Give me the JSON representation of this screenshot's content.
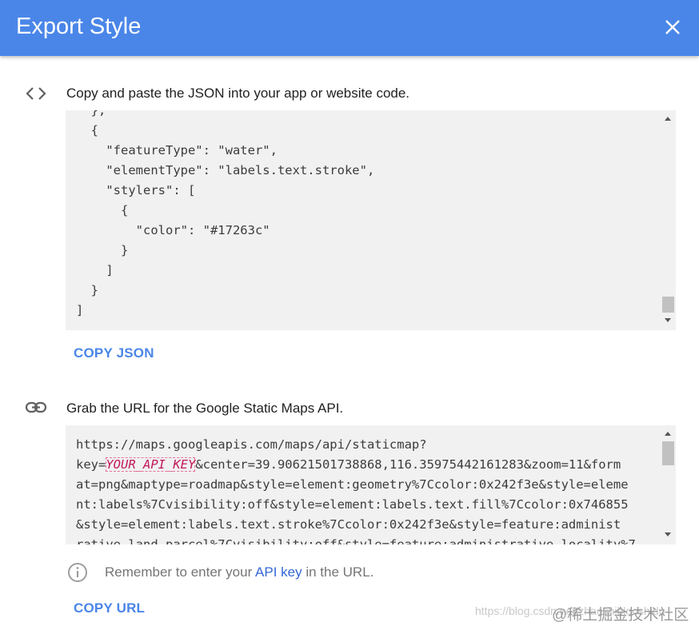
{
  "dialog": {
    "title": "Export Style"
  },
  "json_section": {
    "description": "Copy and paste the JSON into your app or website code.",
    "lines": [
      "  },",
      "  {",
      "    \"featureType\": \"water\",",
      "    \"elementType\": \"labels.text.stroke\",",
      "    \"stylers\": [",
      "      {",
      "        \"color\": \"#17263c\"",
      "      }",
      "    ]",
      "  }",
      "]"
    ],
    "copy_label": "COPY JSON"
  },
  "url_section": {
    "description": "Grab the URL for the Google Static Maps API.",
    "line1": "https://maps.googleapis.com/maps/api/staticmap?",
    "line2_prefix": "key=",
    "api_key_placeholder": "YOUR_API_KEY",
    "line2_suffix": "&center=39.90621501738868,116.35975442161283&zoom=11&form",
    "lines_rest": [
      "at=png&maptype=roadmap&style=element:geometry%7Ccolor:0x242f3e&style=eleme",
      "nt:labels%7Cvisibility:off&style=element:labels.text.fill%7Ccolor:0x746855",
      "&style=element:labels.text.stroke%7Ccolor:0x242f3e&style=feature:administ",
      "rative.land_parcel%7Cvisibility:off&style=feature:administrative.locality%7"
    ],
    "hint_prefix": "Remember to enter your ",
    "hint_link": "API key",
    "hint_suffix": " in the URL.",
    "copy_label": "COPY URL"
  },
  "watermark": {
    "url_text": "https://blog.csdn.net/zhaoshiblooshidu",
    "brand_text": "@稀土掘金技术社区"
  },
  "icons": {
    "close": "close-icon",
    "code": "code-icon",
    "link": "link-icon",
    "info": "info-icon"
  },
  "colors": {
    "header": "#4a86e8",
    "accent": "#4a86e8",
    "code_background": "#f1f1f1",
    "api_key": "#c2185b"
  }
}
